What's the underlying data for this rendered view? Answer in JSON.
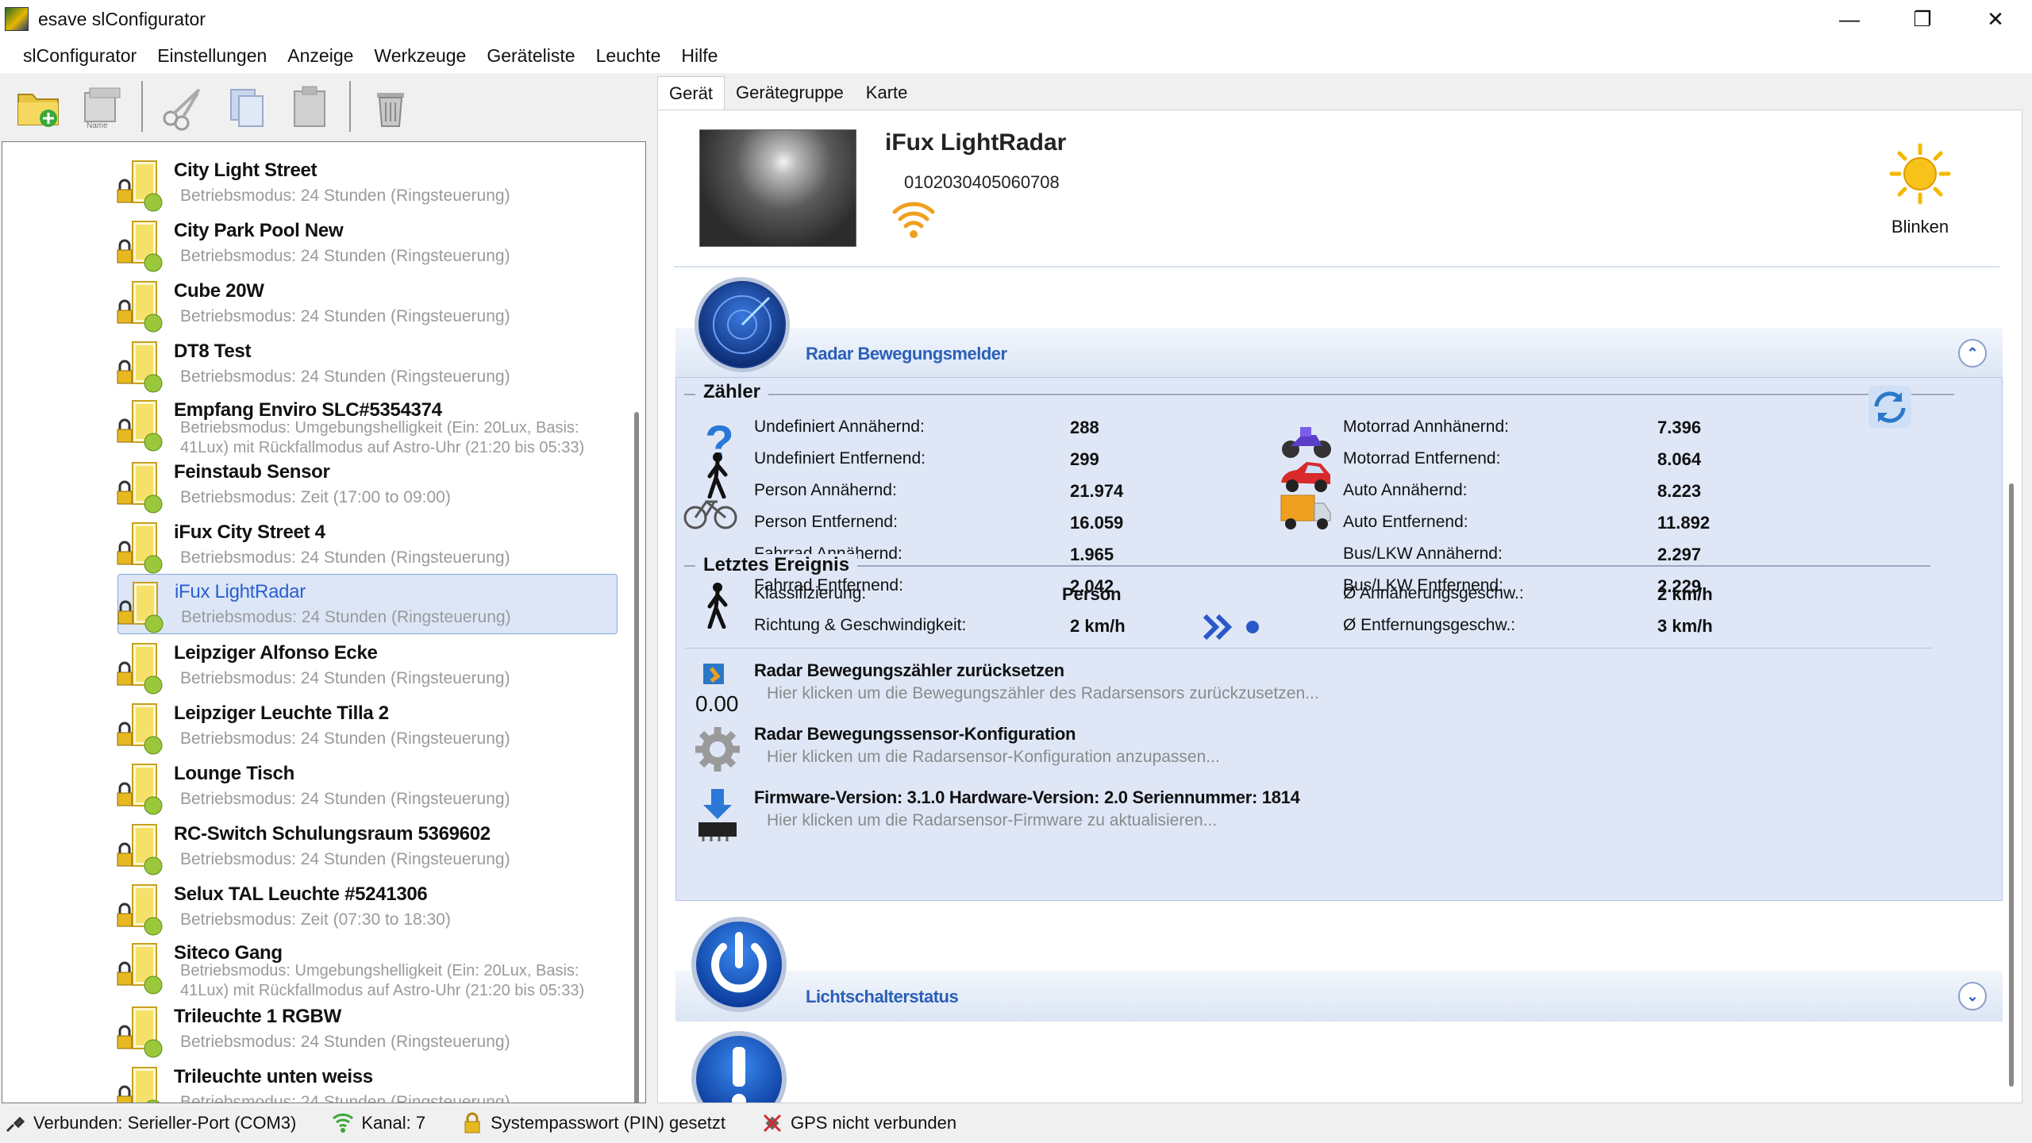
{
  "window": {
    "title": "esave slConfigurator"
  },
  "menu": [
    "slConfigurator",
    "Einstellungen",
    "Anzeige",
    "Werkzeuge",
    "Geräteliste",
    "Leuchte",
    "Hilfe"
  ],
  "toolbar": {
    "name_icon_caption": "Name"
  },
  "tree": {
    "items": [
      {
        "name": "City Light Street",
        "mode": "Betriebsmodus: 24 Stunden (Ringsteuerung)"
      },
      {
        "name": "City Park Pool New",
        "mode": "Betriebsmodus: 24 Stunden (Ringsteuerung)"
      },
      {
        "name": "Cube 20W",
        "mode": "Betriebsmodus: 24 Stunden (Ringsteuerung)"
      },
      {
        "name": "DT8 Test",
        "mode": "Betriebsmodus: 24 Stunden (Ringsteuerung)"
      },
      {
        "name": "Empfang Enviro SLC#5354374",
        "mode": "Betriebsmodus: Umgebungshelligkeit (Ein: 20Lux, Basis: 41Lux) mit Rückfallmodus auf Astro-Uhr (21:20 bis 05:33)"
      },
      {
        "name": "Feinstaub Sensor",
        "mode": "Betriebsmodus: Zeit (17:00 to 09:00)"
      },
      {
        "name": "iFux City Street 4",
        "mode": "Betriebsmodus: 24 Stunden (Ringsteuerung)"
      },
      {
        "name": "iFux LightRadar",
        "mode": "Betriebsmodus: 24 Stunden (Ringsteuerung)"
      },
      {
        "name": "Leipziger Alfonso Ecke",
        "mode": "Betriebsmodus: 24 Stunden (Ringsteuerung)"
      },
      {
        "name": "Leipziger Leuchte Tilla 2",
        "mode": "Betriebsmodus: 24 Stunden (Ringsteuerung)"
      },
      {
        "name": "Lounge Tisch",
        "mode": "Betriebsmodus: 24 Stunden (Ringsteuerung)"
      },
      {
        "name": "RC-Switch Schulungsraum 5369602",
        "mode": "Betriebsmodus: 24 Stunden (Ringsteuerung)"
      },
      {
        "name": "Selux TAL Leuchte #5241306",
        "mode": "Betriebsmodus: Zeit (07:30 to 18:30)"
      },
      {
        "name": "Siteco Gang",
        "mode": "Betriebsmodus: Umgebungshelligkeit (Ein: 20Lux, Basis: 41Lux) mit Rückfallmodus auf Astro-Uhr (21:20 bis 05:33)"
      },
      {
        "name": "Trileuchte 1 RGBW",
        "mode": "Betriebsmodus: 24 Stunden (Ringsteuerung)"
      },
      {
        "name": "Trileuchte unten weiss",
        "mode": "Betriebsmodus: 24 Stunden (Ringsteuerung)"
      }
    ]
  },
  "tabs": [
    "Gerät",
    "Gerätegruppe",
    "Karte"
  ],
  "device": {
    "name": "iFux LightRadar",
    "serial": "0102030405060708",
    "blink_label": "Blinken"
  },
  "radar": {
    "title": "Radar Bewegungsmelder",
    "counter_group": "Zähler",
    "counters_left": [
      {
        "label": "Undefiniert Annähernd:",
        "value": "288"
      },
      {
        "label": "Undefiniert Entfernend:",
        "value": "299"
      },
      {
        "label": "Person Annähernd:",
        "value": "21.974"
      },
      {
        "label": "Person Entfernend:",
        "value": "16.059"
      },
      {
        "label": "Fahrrad Annähernd:",
        "value": "1.965"
      },
      {
        "label": "Fahrrad Entfernend:",
        "value": "2.042"
      }
    ],
    "counters_right": [
      {
        "label": "Motorrad Annhänernd:",
        "value": "7.396"
      },
      {
        "label": "Motorrad Entfernend:",
        "value": "8.064"
      },
      {
        "label": "Auto Annähernd:",
        "value": "8.223"
      },
      {
        "label": "Auto Entfernend:",
        "value": "11.892"
      },
      {
        "label": "Bus/LKW Annähernd:",
        "value": "2.297"
      },
      {
        "label": "Bus/LKW Entfernend:",
        "value": "2.229"
      }
    ],
    "last_event_group": "Letztes Ereignis",
    "last_event": {
      "class_label": "Klassifizierung:",
      "class_value": "Person",
      "dir_label": "Richtung & Geschwindigkeit:",
      "dir_value": "2 km/h",
      "approach_label": "Ø Annäherungsgeschw.:",
      "approach_value": "2 km/h",
      "depart_label": "Ø Entfernungsgeschw.:",
      "depart_value": "3 km/h"
    },
    "actions": [
      {
        "title": "Radar Bewegungszähler zurücksetzen",
        "sub": "Hier klicken um die Bewegungszähler des Radarsensors zurückzusetzen..."
      },
      {
        "title": "Radar Bewegungssensor-Konfiguration",
        "sub": "Hier klicken um die Radarsensor-Konfiguration anzupassen..."
      },
      {
        "title": "Firmware-Version: 3.1.0 Hardware-Version: 2.0 Seriennummer: 1814",
        "sub": "Hier klicken um die Radarsensor-Firmware zu aktualisieren..."
      }
    ],
    "reset_icon_text": "0.00"
  },
  "lightswitch": {
    "title": "Lichtschalterstatus"
  },
  "status": [
    {
      "icon": "connection-icon",
      "text": "Verbunden: Serieller-Port (COM3)"
    },
    {
      "icon": "signal-icon",
      "text": "Kanal: 7"
    },
    {
      "icon": "lock-icon",
      "text": "Systempasswort (PIN) gesetzt"
    },
    {
      "icon": "gps-icon",
      "text": "GPS nicht verbunden"
    }
  ],
  "colors": {
    "accent": "#2b5fb8",
    "section_bg": "#dfe7f7",
    "selected_bg": "#dce6f7"
  }
}
